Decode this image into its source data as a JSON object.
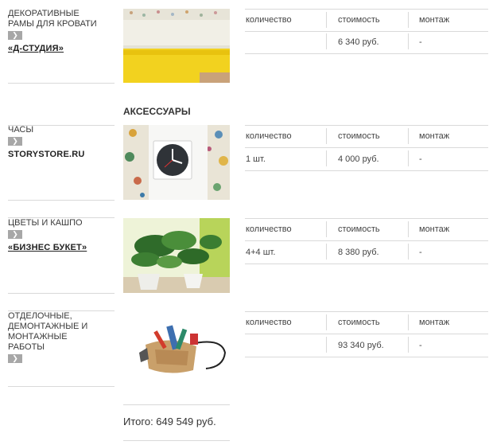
{
  "items": [
    {
      "category": "ДЕКОРАТИВНЫЕ РАМЫ ДЛЯ КРОВАТИ",
      "supplier": "«Д-СТУДИЯ»",
      "image": "bed-frame-photo",
      "headers": {
        "qty": "количество",
        "cost": "стоимость",
        "mount": "монтаж"
      },
      "values": {
        "qty": "",
        "cost": "6 340 руб.",
        "mount": "-"
      }
    },
    {
      "category": "ЧАСЫ",
      "supplier": "STORYSTORE.RU",
      "image": "clock-photo",
      "headers": {
        "qty": "количество",
        "cost": "стоимость",
        "mount": "монтаж"
      },
      "values": {
        "qty": "1 шт.",
        "cost": "4 000 руб.",
        "mount": "-"
      }
    },
    {
      "category": "ЦВЕТЫ И КАШПО",
      "supplier": "«БИЗНЕС БУКЕТ»",
      "image": "plants-photo",
      "headers": {
        "qty": "количество",
        "cost": "стоимость",
        "mount": "монтаж"
      },
      "values": {
        "qty": "4+4 шт.",
        "cost": "8 380 руб.",
        "mount": "-"
      }
    },
    {
      "category": "ОТДЕЛОЧНЫЕ, ДЕМОНТАЖНЫЕ И МОНТАЖНЫЕ РАБОТЫ",
      "supplier": "",
      "image": "tools-photo",
      "headers": {
        "qty": "количество",
        "cost": "стоимость",
        "mount": "монтаж"
      },
      "values": {
        "qty": "",
        "cost": "93 340 руб.",
        "mount": "-"
      }
    }
  ],
  "section_title": "АКСЕССУАРЫ",
  "chevron_icon": "chevron-right-icon",
  "total": "Итого: 649 549 руб."
}
